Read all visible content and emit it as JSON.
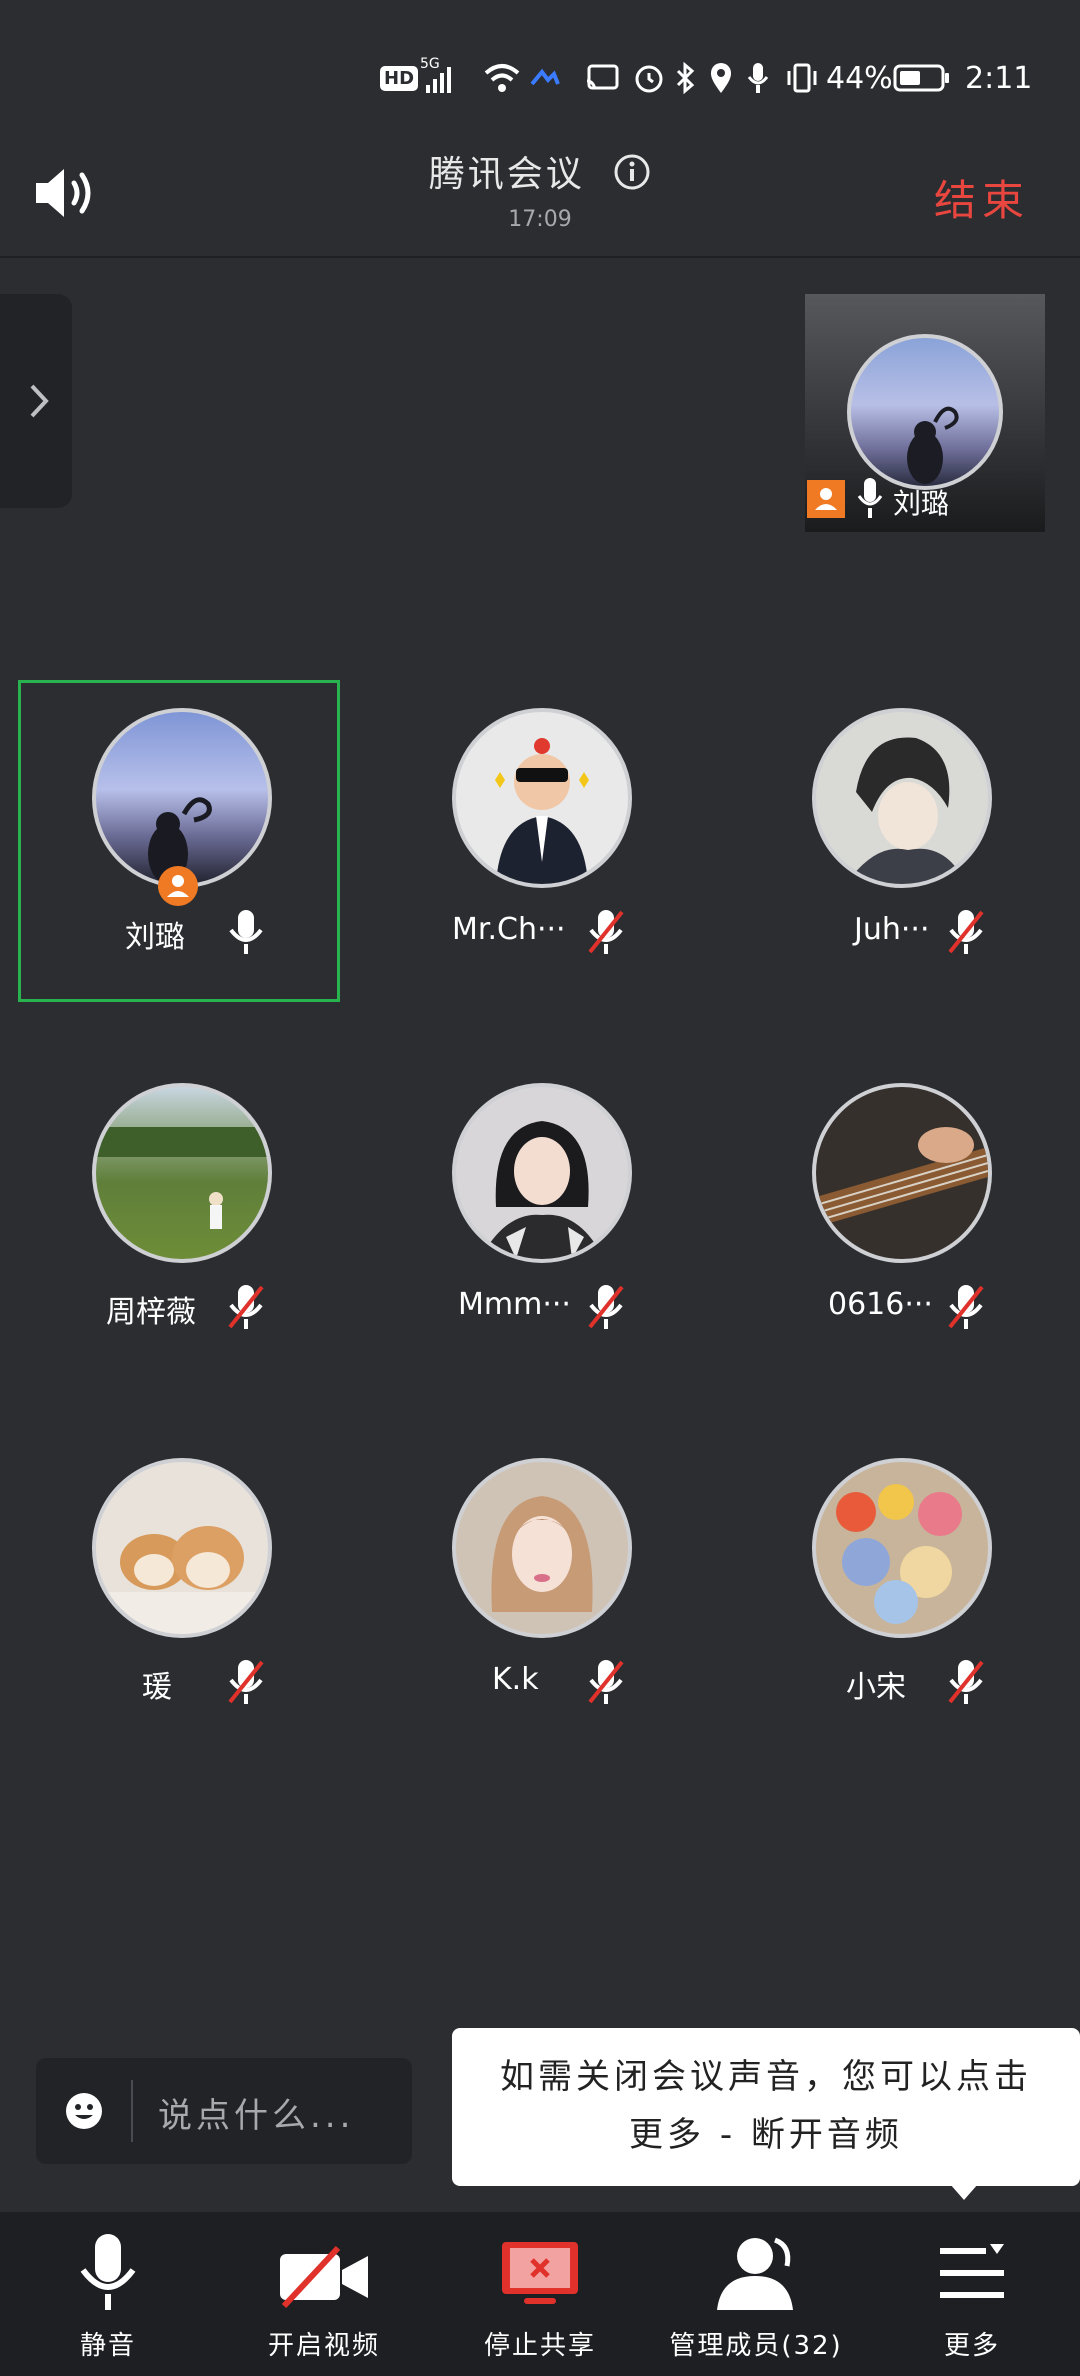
{
  "status_bar": {
    "hd": "HD",
    "network": "5G",
    "battery": "44%",
    "time": "2:11"
  },
  "header": {
    "title": "腾讯会议",
    "timer": "17:09",
    "end_label": "结束"
  },
  "floating_video": {
    "name": "刘璐"
  },
  "participants": [
    {
      "name": "刘璐",
      "mic": "on",
      "host": true
    },
    {
      "name": "Mr.Ch···",
      "mic": "muted"
    },
    {
      "name": "Juh···",
      "mic": "muted"
    },
    {
      "name": "周梓薇",
      "mic": "muted"
    },
    {
      "name": "Mmm···",
      "mic": "muted"
    },
    {
      "name": "0616···",
      "mic": "muted"
    },
    {
      "name": "瑗",
      "mic": "muted"
    },
    {
      "name": "K.k",
      "mic": "muted"
    },
    {
      "name": "小宋",
      "mic": "muted"
    }
  ],
  "chat": {
    "placeholder": "说点什么..."
  },
  "tooltip": {
    "line1": "如需关闭会议声音，您可以点击",
    "line2": "更多 - 断开音频"
  },
  "toolbar": {
    "mute_label": "静音",
    "video_label": "开启视频",
    "share_label": "停止共享",
    "members_label": "管理成员(32)",
    "more_label": "更多"
  },
  "colors": {
    "background": "#2b2d31",
    "accent_green": "#29b34e",
    "end_red": "#e8463e",
    "mute_red": "#e0312b",
    "host_orange": "#f07a23"
  }
}
